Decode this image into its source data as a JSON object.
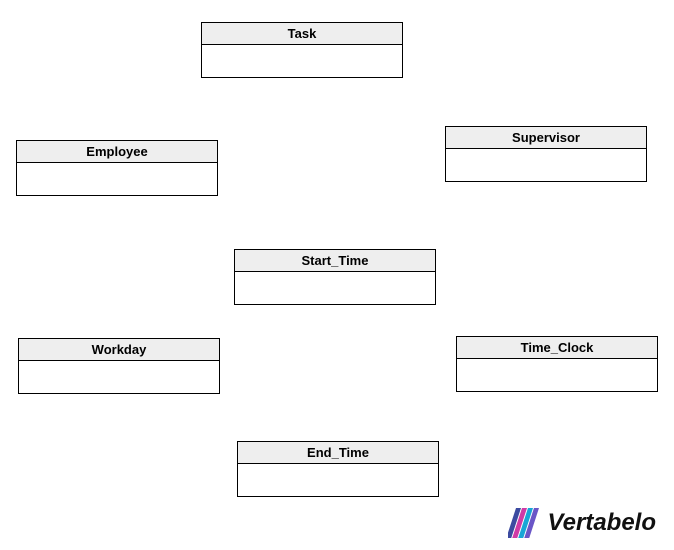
{
  "entities": {
    "task": {
      "label": "Task"
    },
    "employee": {
      "label": "Employee"
    },
    "supervisor": {
      "label": "Supervisor"
    },
    "start_time": {
      "label": "Start_Time"
    },
    "workday": {
      "label": "Workday"
    },
    "time_clock": {
      "label": "Time_Clock"
    },
    "end_time": {
      "label": "End_Time"
    }
  },
  "branding": {
    "name": "Vertabelo"
  }
}
